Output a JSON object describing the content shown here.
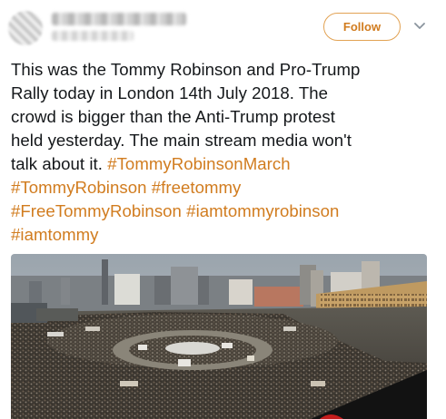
{
  "header": {
    "follow_label": "Follow",
    "accent_color": "#d17c1f"
  },
  "tweet": {
    "lines": [
      [
        {
          "t": "This was the Tommy Robinson and Pro-Trump",
          "h": false
        }
      ],
      [
        {
          "t": "Rally today in London 14th July 2018. The",
          "h": false
        }
      ],
      [
        {
          "t": "crowd is bigger than the Anti-Trump protest",
          "h": false
        }
      ],
      [
        {
          "t": "held yesterday. The main stream media won't",
          "h": false
        }
      ],
      [
        {
          "t": "talk about it. ",
          "h": false
        },
        {
          "t": "#TommyRobinsonMarch",
          "h": true
        }
      ],
      [
        {
          "t": "#TommyRobinson",
          "h": true
        },
        {
          "t": " ",
          "h": false
        },
        {
          "t": "#freetommy",
          "h": true
        }
      ],
      [
        {
          "t": "#FreeTommyRobinson",
          "h": true
        },
        {
          "t": " ",
          "h": false
        },
        {
          "t": "#iamtommyrobinson",
          "h": true
        }
      ],
      [
        {
          "t": "#iamtommy",
          "h": true
        }
      ]
    ]
  },
  "media": {
    "icons": [
      "chevron-down-icon"
    ]
  }
}
